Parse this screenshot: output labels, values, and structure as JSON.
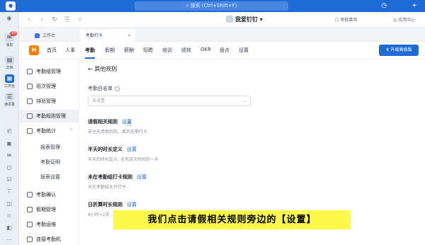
{
  "topbar": {
    "search_placeholder": "搜索 (Ctrl+Shift+F)"
  },
  "rail": {
    "items": [
      {
        "label": "消息",
        "icon": "message-icon",
        "badge": "99"
      },
      {
        "label": "文档",
        "icon": "document-icon"
      },
      {
        "label": "工作台",
        "icon": "workbench-icon"
      },
      {
        "label": "通讯录",
        "icon": "contacts-icon"
      }
    ]
  },
  "navrow": {
    "app_title": "我爱钉钉",
    "approval_label": "审批事项",
    "app_center_label": "应用中心"
  },
  "tabs": [
    {
      "label": "工作台"
    },
    {
      "label": "考勤打卡"
    }
  ],
  "menu": {
    "items": [
      "首页",
      "人事",
      "考勤",
      "假期",
      "薪酬",
      "招聘",
      "培训",
      "绩效",
      "OKR",
      "盘点",
      "设置"
    ],
    "active": "考勤",
    "upgrade_label": "升级高级版"
  },
  "side": {
    "items": [
      {
        "label": "考勤组管理"
      },
      {
        "label": "班次管理"
      },
      {
        "label": "排班管理"
      },
      {
        "label": "考勤规则管理"
      },
      {
        "label": "考勤统计"
      },
      {
        "label": "报表管理"
      },
      {
        "label": "考勤证明"
      },
      {
        "label": "报表设置"
      },
      {
        "label": "考勤确认"
      },
      {
        "label": "假期管理"
      },
      {
        "label": "考勤运维"
      },
      {
        "label": "连接考勤机"
      }
    ]
  },
  "content": {
    "back_label": "其他规则",
    "whitelist_label": "考勤白名单",
    "whitelist_placeholder": "未设置",
    "rules": [
      {
        "title": "请假相关规则",
        "link": "设置",
        "desc": "非全天请假到岗、离岗无需打卡"
      },
      {
        "title": "半天的时长定义",
        "link": "设置",
        "desc": "半天的时长定义: 全天班次时间的一半"
      },
      {
        "title": "未在考勤组打卡规则",
        "link": "设置",
        "desc": "未在考勤组允许打卡"
      },
      {
        "title": "日折算时长规则",
        "link": "设置",
        "desc": "8小时=1天"
      }
    ]
  },
  "caption": "我们点击请假相关规则旁边的【设置】",
  "colors": {
    "primary": "#1f6bd6",
    "caption_bg": "#fdf94a",
    "logo_orange": "#ff7d00"
  }
}
